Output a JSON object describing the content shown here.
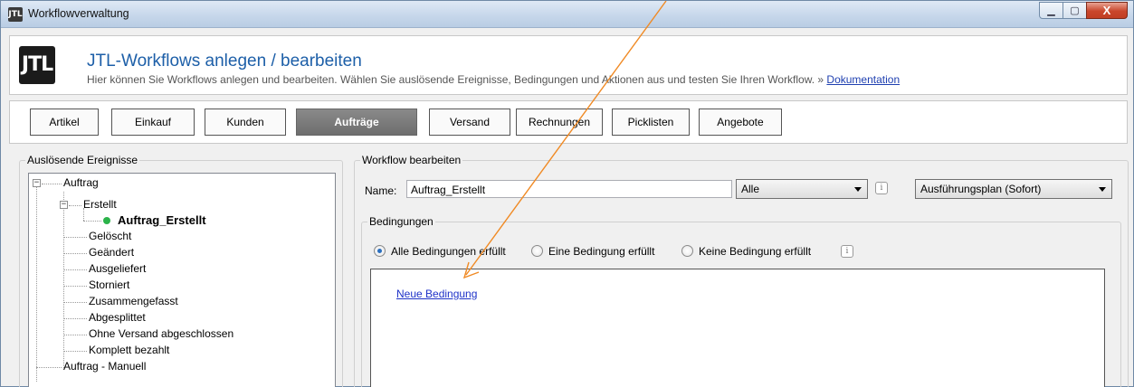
{
  "window": {
    "app_icon": "JTL",
    "title": "Workflowverwaltung",
    "caption_buttons": {
      "minimize": "▁",
      "maximize": "▢",
      "close": "X"
    }
  },
  "header": {
    "logo_text": "JTL",
    "title": "JTL-Workflows anlegen / bearbeiten",
    "subtitle": "Hier können Sie Workflows anlegen und bearbeiten. Wählen Sie auslösende Ereignisse, Bedingungen und Aktionen aus und testen Sie Ihren Workflow. » ",
    "doc_link": "Dokumentation"
  },
  "tabs": [
    {
      "label": "Artikel"
    },
    {
      "label": "Einkauf"
    },
    {
      "label": "Kunden"
    },
    {
      "label": "Aufträge",
      "active": true
    },
    {
      "label": "Versand"
    },
    {
      "label": "Rechnungen"
    },
    {
      "label": "Picklisten"
    },
    {
      "label": "Angebote"
    }
  ],
  "events_panel": {
    "legend": "Auslösende Ereignisse",
    "tree": {
      "root": "Auftrag",
      "child": "Erstellt",
      "selected": "Auftrag_Erstellt",
      "items": [
        "Gelöscht",
        "Geändert",
        "Ausgeliefert",
        "Storniert",
        "Zusammengefasst",
        "Abgesplittet",
        "Ohne Versand abgeschlossen",
        "Komplett bezahlt"
      ],
      "sibling_root": "Auftrag - Manuell"
    }
  },
  "workflow_panel": {
    "legend": "Workflow bearbeiten",
    "name_label": "Name:",
    "name_value": "Auftrag_Erstellt",
    "scope_select": "Alle",
    "plan_select": "Ausführungsplan (Sofort)",
    "info_glyph": "i"
  },
  "conditions": {
    "legend": "Bedingungen",
    "options": [
      "Alle Bedingungen erfüllt",
      "Eine Bedingung erfüllt",
      "Keine Bedingung erfüllt"
    ],
    "selected_index": 0,
    "new_condition_link": "Neue Bedingung"
  },
  "colors": {
    "accent": "#1d5fa8",
    "annotation_arrow": "#f08a24",
    "active_tab": "#7a7a7a",
    "link": "#1e32c8",
    "status_dot": "#2bb34a"
  }
}
